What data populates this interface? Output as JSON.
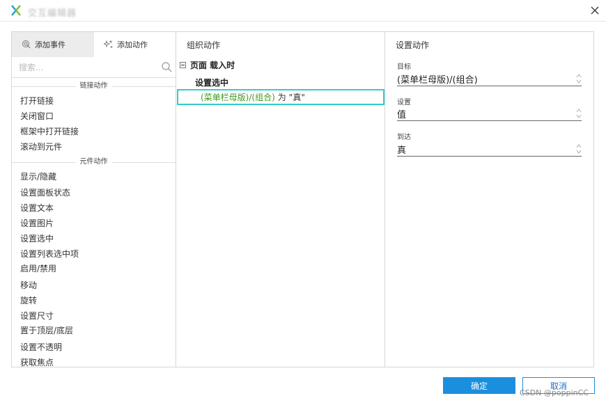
{
  "window": {
    "title": "交互编辑器",
    "close_icon": "close-icon",
    "logo_icon": "axure-x-logo"
  },
  "left_panel": {
    "tabs": [
      {
        "label": "添加事件",
        "icon": "event-icon",
        "active": true
      },
      {
        "label": "添加动作",
        "icon": "sparkle-icon",
        "active": false
      }
    ],
    "search_placeholder": "搜索...",
    "sections": [
      {
        "header": "链接动作",
        "items": [
          "打开链接",
          "关闭窗口",
          "框架中打开链接",
          "滚动到元件"
        ]
      },
      {
        "header": "元件动作",
        "items": [
          "显示/隐藏",
          "设置面板状态",
          "设置文本",
          "设置图片",
          "设置选中",
          "设置列表选中项",
          "启用/禁用",
          "移动",
          "旋转",
          "设置尺寸",
          "置于顶层/底层",
          "设置不透明",
          "获取焦点"
        ]
      }
    ]
  },
  "middle_panel": {
    "title": "组织动作",
    "event": "页面 载入时",
    "action": "设置选中",
    "detail": {
      "target": "(菜单栏母版)/(组合)",
      "op": "为",
      "value": "\"真\""
    }
  },
  "right_panel": {
    "title": "设置动作",
    "fields": [
      {
        "label": "目标",
        "value": "(菜单栏母版)/(组合)"
      },
      {
        "label": "设置",
        "value": "值"
      },
      {
        "label": "到达",
        "value": "真"
      }
    ]
  },
  "footer": {
    "ok_label": "确定",
    "cancel_label": "取消",
    "ok_color": "#1a8fdd"
  },
  "watermark": "CSDN @poppinCC"
}
